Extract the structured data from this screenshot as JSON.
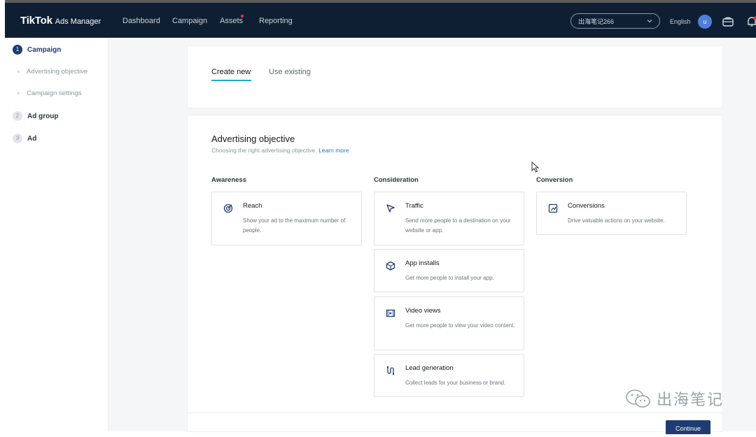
{
  "header": {
    "brand": "TikTok",
    "product": "Ads Manager",
    "nav": [
      {
        "label": "Dashboard",
        "has_dot": false
      },
      {
        "label": "Campaign",
        "has_dot": false
      },
      {
        "label": "Assets",
        "has_dot": true
      },
      {
        "label": "Reporting",
        "has_dot": false
      }
    ],
    "account": "出海笔记266",
    "language": "English",
    "avatar_initial": "u",
    "icons": [
      "briefcase-icon",
      "bell-icon"
    ],
    "colors": {
      "background": "#0f1f33",
      "notification_dot": "#fe2c55"
    }
  },
  "sidebar": {
    "steps": [
      {
        "number": "1",
        "label": "Campaign",
        "active": true
      },
      {
        "number": "2",
        "label": "Ad group",
        "active": false
      },
      {
        "number": "3",
        "label": "Ad",
        "active": false
      }
    ],
    "substeps": [
      "Advertising objective",
      "Campaign settings"
    ]
  },
  "tabs": {
    "create_new": "Create new",
    "use_existing": "Use existing"
  },
  "objective": {
    "title": "Advertising objective",
    "subtitle": "Choosing the right advertising objective.",
    "learn_more": "Learn more",
    "columns": {
      "awareness": "Awareness",
      "consideration": "Consideration",
      "conversion": "Conversion"
    },
    "options": {
      "reach": {
        "title": "Reach",
        "desc": "Show your ad to the maximum number of people.",
        "icon": "target-icon"
      },
      "traffic": {
        "title": "Traffic",
        "desc": "Send more people to a destination on your website or app.",
        "icon": "cursor-arrow-icon"
      },
      "app_installs": {
        "title": "App installs",
        "desc": "Get more people to install your app.",
        "icon": "box-icon"
      },
      "video_views": {
        "title": "Video views",
        "desc": "Get more people to view your video content.",
        "icon": "video-icon"
      },
      "lead_generation": {
        "title": "Lead generation",
        "desc": "Collect leads for your business or brand.",
        "icon": "funnel-icon"
      },
      "conversions": {
        "title": "Conversions",
        "desc": "Drive valuable actions on your website.",
        "icon": "chart-up-icon"
      }
    }
  },
  "footer": {
    "continue_label": "Continue"
  },
  "watermark": {
    "text": "出海笔记",
    "icon": "wechat-icon"
  },
  "colors": {
    "primary": "#1e3c72",
    "tab_underline": "#25a3d4",
    "link": "#2a6fc9"
  }
}
